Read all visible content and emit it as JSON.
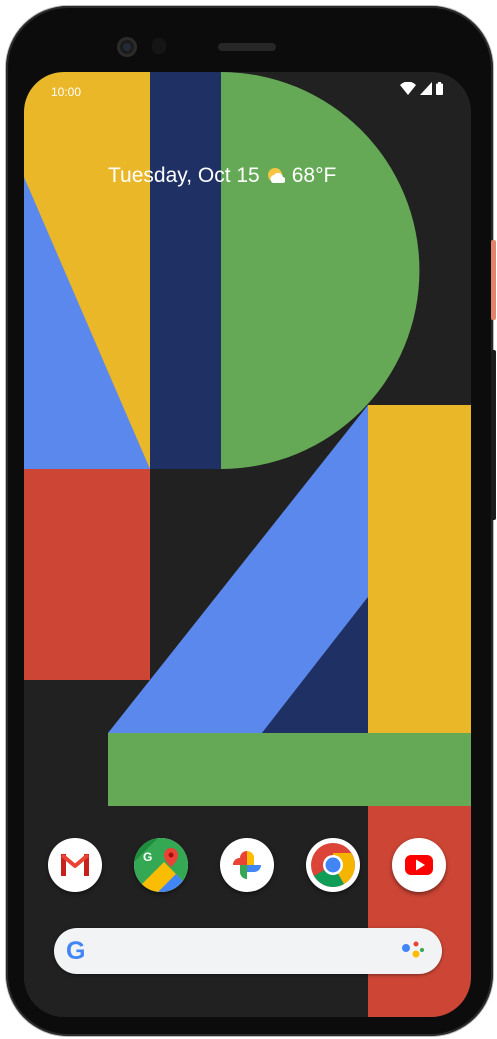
{
  "status_bar": {
    "time": "10:00",
    "icons": [
      "wifi-icon",
      "cellular-signal-icon",
      "battery-icon"
    ]
  },
  "at_a_glance": {
    "date": "Tuesday, Oct 15",
    "weather_icon": "partly-sunny-icon",
    "temperature": "68°F"
  },
  "dock": {
    "apps": [
      {
        "name": "Gmail",
        "icon": "gmail-icon"
      },
      {
        "name": "Maps",
        "icon": "maps-icon"
      },
      {
        "name": "Photos",
        "icon": "photos-icon"
      },
      {
        "name": "Chrome",
        "icon": "chrome-icon"
      },
      {
        "name": "YouTube",
        "icon": "youtube-icon"
      }
    ]
  },
  "search_bar": {
    "logo_letter": "G",
    "assistant_icon": "google-assistant-icon"
  },
  "wallpaper": {
    "colors": {
      "yellow": "#eab729",
      "navy": "#1f3164",
      "green": "#65a957",
      "blue": "#5b88ed",
      "red": "#cc4535",
      "dark": "#212121"
    }
  }
}
